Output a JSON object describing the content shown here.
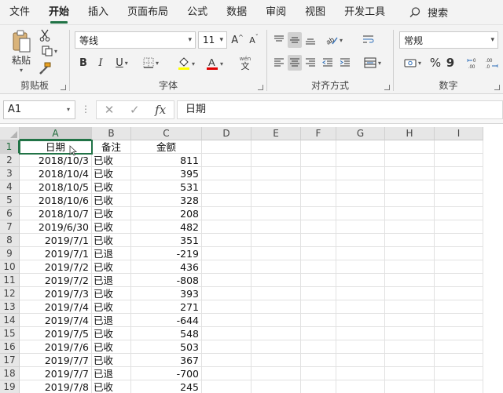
{
  "menu": {
    "tabs": [
      "文件",
      "开始",
      "插入",
      "页面布局",
      "公式",
      "数据",
      "审阅",
      "视图",
      "开发工具"
    ],
    "active_tab": "开始",
    "search_label": "搜索"
  },
  "ribbon": {
    "clipboard": {
      "label": "剪贴板",
      "paste_label": "粘贴"
    },
    "font": {
      "label": "字体",
      "font_name": "等线",
      "font_size": "11",
      "bold": "B",
      "italic": "I",
      "underline": "U",
      "grow": "A",
      "shrink": "A",
      "wen_label": "wén"
    },
    "alignment": {
      "label": "对齐方式"
    },
    "number": {
      "label": "数字",
      "format": "常规",
      "percent": "%",
      "comma": "9"
    }
  },
  "formula_bar": {
    "name_box": "A1",
    "cancel": "✕",
    "enter": "✓",
    "fx": "fx",
    "value": "日期"
  },
  "sheet": {
    "active_cell": "A1",
    "columns": [
      "A",
      "B",
      "C",
      "D",
      "E",
      "F",
      "G",
      "H",
      "I"
    ],
    "rows": [
      [
        "1",
        "日期",
        "备注",
        "金额"
      ],
      [
        "2",
        "2018/10/3",
        "已收",
        "811"
      ],
      [
        "3",
        "2018/10/4",
        "已收",
        "395"
      ],
      [
        "4",
        "2018/10/5",
        "已收",
        "531"
      ],
      [
        "5",
        "2018/10/6",
        "已收",
        "328"
      ],
      [
        "6",
        "2018/10/7",
        "已收",
        "208"
      ],
      [
        "7",
        "2019/6/30",
        "已收",
        "482"
      ],
      [
        "8",
        "2019/7/1",
        "已收",
        "351"
      ],
      [
        "9",
        "2019/7/1",
        "已退",
        "-219"
      ],
      [
        "10",
        "2019/7/2",
        "已收",
        "436"
      ],
      [
        "11",
        "2019/7/2",
        "已退",
        "-808"
      ],
      [
        "12",
        "2019/7/3",
        "已收",
        "393"
      ],
      [
        "13",
        "2019/7/4",
        "已收",
        "271"
      ],
      [
        "14",
        "2019/7/4",
        "已退",
        "-644"
      ],
      [
        "15",
        "2019/7/5",
        "已收",
        "548"
      ],
      [
        "16",
        "2019/7/6",
        "已收",
        "503"
      ],
      [
        "17",
        "2019/7/7",
        "已收",
        "367"
      ],
      [
        "18",
        "2019/7/7",
        "已退",
        "-700"
      ],
      [
        "19",
        "2019/7/8",
        "已收",
        "245"
      ]
    ]
  },
  "colors": {
    "accent": "#217346",
    "font_color_bar": "#e00000",
    "fill_color_bar": "#ffff00"
  }
}
